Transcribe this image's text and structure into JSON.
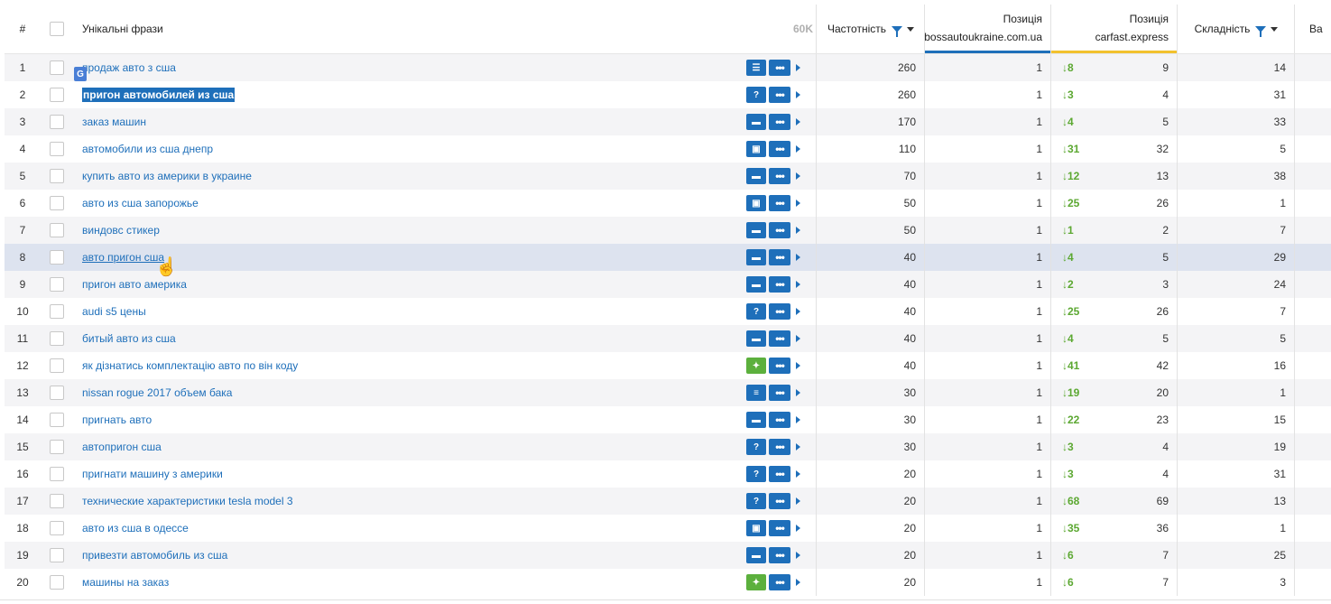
{
  "header": {
    "num": "#",
    "phrases": "Унікальні фрази",
    "count": "60K",
    "frequency": "Частотність",
    "pos1_title": "Позиція",
    "pos1_domain": "bossautoukraine.com.ua",
    "pos2_title": "Позиція",
    "pos2_domain": "carfast.express",
    "difficulty": "Складність",
    "extra": "Ва"
  },
  "rows": [
    {
      "n": "1",
      "phrase": "продаж авто з сша",
      "icon": "list",
      "freq": "260",
      "p1": "1",
      "delta": "↓8",
      "p2": "9",
      "diff": "14"
    },
    {
      "n": "2",
      "phrase": "пригон автомобилей из сша",
      "icon": "question",
      "freq": "260",
      "p1": "1",
      "delta": "↓3",
      "p2": "4",
      "diff": "31"
    },
    {
      "n": "3",
      "phrase": "заказ машин",
      "icon": "chat",
      "freq": "170",
      "p1": "1",
      "delta": "↓4",
      "p2": "5",
      "diff": "33"
    },
    {
      "n": "4",
      "phrase": "автомобили из сша днепр",
      "icon": "store",
      "freq": "110",
      "p1": "1",
      "delta": "↓31",
      "p2": "32",
      "diff": "5"
    },
    {
      "n": "5",
      "phrase": "купить авто из америки в украине",
      "icon": "chat",
      "freq": "70",
      "p1": "1",
      "delta": "↓12",
      "p2": "13",
      "diff": "38"
    },
    {
      "n": "6",
      "phrase": "авто из сша запорожье",
      "icon": "store",
      "freq": "50",
      "p1": "1",
      "delta": "↓25",
      "p2": "26",
      "diff": "1"
    },
    {
      "n": "7",
      "phrase": "виндовс стикер",
      "icon": "chat",
      "freq": "50",
      "p1": "1",
      "delta": "↓1",
      "p2": "2",
      "diff": "7"
    },
    {
      "n": "8",
      "phrase": "авто пригон сша",
      "icon": "chat",
      "freq": "40",
      "p1": "1",
      "delta": "↓4",
      "p2": "5",
      "diff": "29"
    },
    {
      "n": "9",
      "phrase": "пригон авто америка",
      "icon": "chat",
      "freq": "40",
      "p1": "1",
      "delta": "↓2",
      "p2": "3",
      "diff": "24"
    },
    {
      "n": "10",
      "phrase": "audi s5 цены",
      "icon": "question",
      "freq": "40",
      "p1": "1",
      "delta": "↓25",
      "p2": "26",
      "diff": "7"
    },
    {
      "n": "11",
      "phrase": "битый авто из сша",
      "icon": "chat",
      "freq": "40",
      "p1": "1",
      "delta": "↓4",
      "p2": "5",
      "diff": "5"
    },
    {
      "n": "12",
      "phrase": "як дізнатись комплектацію авто по він коду",
      "icon": "sparkle",
      "freq": "40",
      "p1": "1",
      "delta": "↓41",
      "p2": "42",
      "diff": "16"
    },
    {
      "n": "13",
      "phrase": "nissan rogue 2017 объем бака",
      "icon": "text",
      "freq": "30",
      "p1": "1",
      "delta": "↓19",
      "p2": "20",
      "diff": "1"
    },
    {
      "n": "14",
      "phrase": "пригнать авто",
      "icon": "chat",
      "freq": "30",
      "p1": "1",
      "delta": "↓22",
      "p2": "23",
      "diff": "15"
    },
    {
      "n": "15",
      "phrase": "автопригон сша",
      "icon": "question",
      "freq": "30",
      "p1": "1",
      "delta": "↓3",
      "p2": "4",
      "diff": "19"
    },
    {
      "n": "16",
      "phrase": "пригнати машину з америки",
      "icon": "question",
      "freq": "20",
      "p1": "1",
      "delta": "↓3",
      "p2": "4",
      "diff": "31"
    },
    {
      "n": "17",
      "phrase": "технические характеристики tesla model 3",
      "icon": "question",
      "freq": "20",
      "p1": "1",
      "delta": "↓68",
      "p2": "69",
      "diff": "13"
    },
    {
      "n": "18",
      "phrase": "авто из сша в одессе",
      "icon": "store",
      "freq": "20",
      "p1": "1",
      "delta": "↓35",
      "p2": "36",
      "diff": "1"
    },
    {
      "n": "19",
      "phrase": "привезти автомобиль из сша",
      "icon": "chat",
      "freq": "20",
      "p1": "1",
      "delta": "↓6",
      "p2": "7",
      "diff": "25"
    },
    {
      "n": "20",
      "phrase": "машины на заказ",
      "icon": "sparkle",
      "freq": "20",
      "p1": "1",
      "delta": "↓6",
      "p2": "7",
      "diff": "3"
    }
  ],
  "selected_row": "2",
  "hover_row": "8",
  "badge": "G",
  "colors": {
    "link": "#1e6fba",
    "accent": "#1e6fba",
    "delta": "#5ca832",
    "pos2_underline": "#f2c12e"
  }
}
